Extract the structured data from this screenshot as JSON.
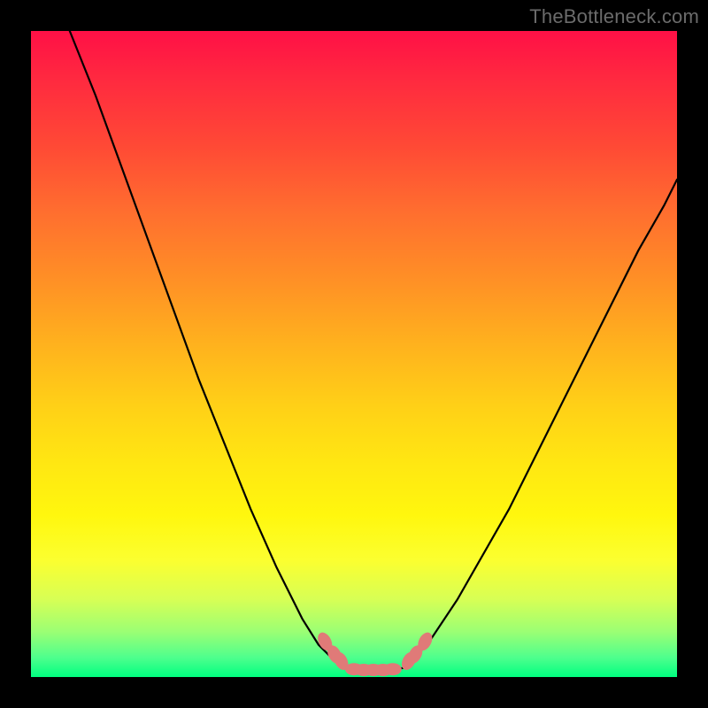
{
  "watermark": "TheBottleneck.com",
  "colors": {
    "background": "#000000",
    "marker": "#e07a78",
    "curve": "#000000"
  },
  "chart_data": {
    "type": "line",
    "title": "",
    "xlabel": "",
    "ylabel": "",
    "x_range": [
      0,
      100
    ],
    "y_range": [
      0,
      100
    ],
    "left_curve": {
      "x": [
        6,
        10,
        14,
        18,
        22,
        26,
        30,
        34,
        38,
        42,
        44.5,
        46.5
      ],
      "y": [
        100,
        90,
        79,
        68,
        57,
        46,
        36,
        26,
        17,
        9,
        5,
        3
      ]
    },
    "flat_bottom": {
      "x": [
        46.5,
        48,
        50,
        52,
        54,
        56,
        58,
        59.5
      ],
      "y": [
        3,
        1.5,
        1,
        1,
        1,
        1,
        1.5,
        3
      ]
    },
    "right_curve": {
      "x": [
        59.5,
        62,
        66,
        70,
        74,
        78,
        82,
        86,
        90,
        94,
        98,
        100
      ],
      "y": [
        3,
        6,
        12,
        19,
        26,
        34,
        42,
        50,
        58,
        66,
        73,
        77
      ]
    },
    "markers_left": {
      "x": [
        45.5,
        47,
        48
      ],
      "y": [
        5.5,
        3.5,
        2.5
      ]
    },
    "markers_right": {
      "x": [
        58.5,
        59.5,
        61
      ],
      "y": [
        2.5,
        3.5,
        5.5
      ]
    },
    "markers_bottom": {
      "x": [
        50,
        51.5,
        53,
        54.5,
        56
      ],
      "y": [
        1.2,
        1.1,
        1.1,
        1.1,
        1.2
      ]
    }
  }
}
